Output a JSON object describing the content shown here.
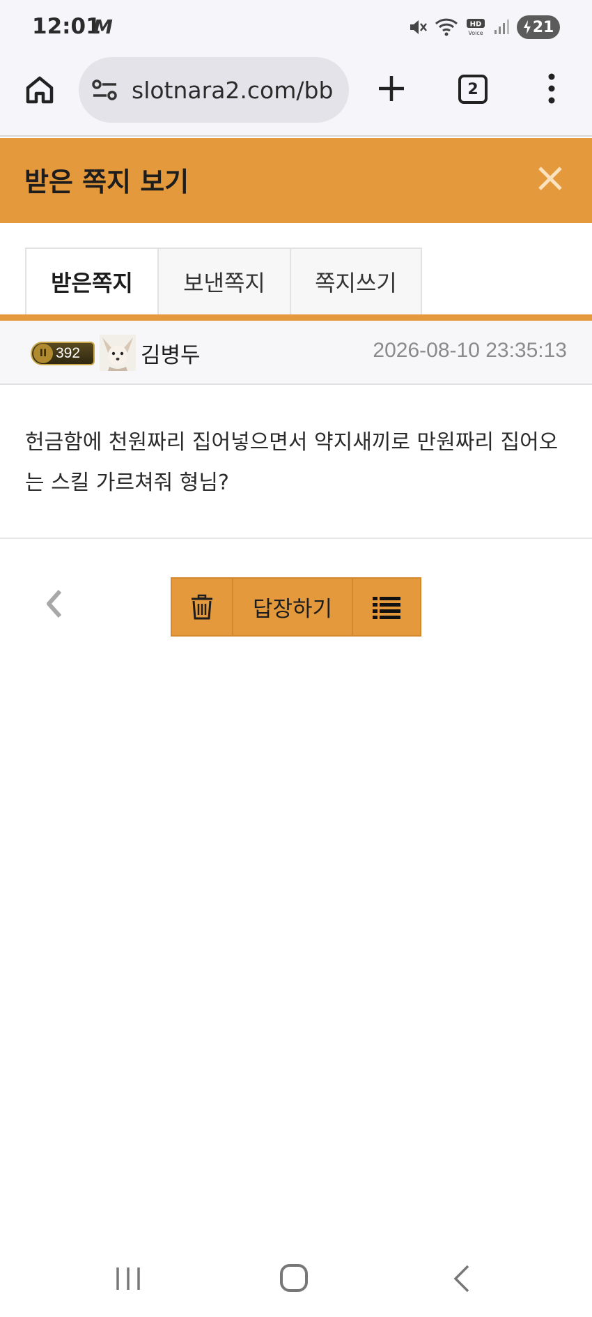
{
  "status_bar": {
    "time": "12:01",
    "carrier_icon": "M",
    "battery": "21"
  },
  "browser": {
    "url": "slotnara2.com/bb",
    "tab_count": "2"
  },
  "header": {
    "title": "받은 쪽지 보기"
  },
  "tabs": [
    {
      "label": "받은쪽지",
      "active": true
    },
    {
      "label": "보낸쪽지",
      "active": false
    },
    {
      "label": "쪽지쓰기",
      "active": false
    }
  ],
  "message": {
    "level": "392",
    "sender": "김병두",
    "date": "2026-08-10 23:35:13",
    "body": "헌금함에 천원짜리 집어넣으면서 약지새끼로 만원짜리 집어오는 스킬 가르쳐줘 형님?"
  },
  "actions": {
    "reply_label": "답장하기"
  },
  "colors": {
    "accent": "#e4993c",
    "accent_border": "#d4882d"
  }
}
